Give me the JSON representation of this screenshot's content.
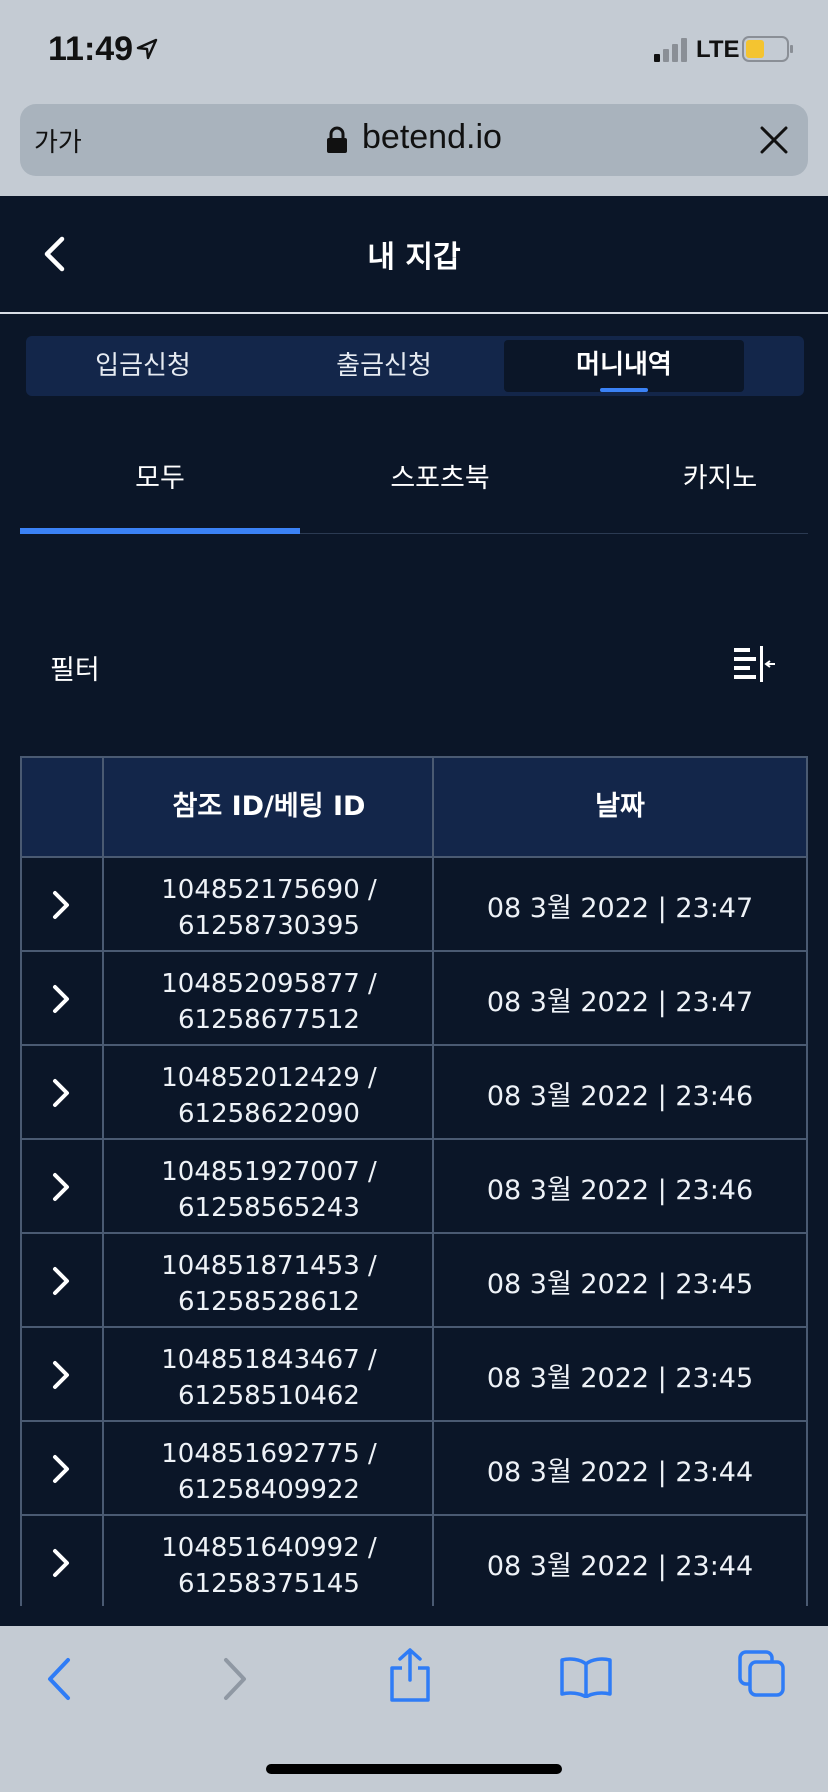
{
  "status_bar": {
    "time": "11:49",
    "network": "LTE"
  },
  "browser": {
    "text_size_label": "가가",
    "url": "betend.io"
  },
  "header": {
    "title": "내 지갑"
  },
  "tabs": [
    {
      "label": "입금신청",
      "active": false
    },
    {
      "label": "출금신청",
      "active": false
    },
    {
      "label": "머니내역",
      "active": true
    }
  ],
  "subtabs": [
    {
      "label": "모두",
      "active": true
    },
    {
      "label": "스포츠북",
      "active": false
    },
    {
      "label": "카지노",
      "active": false
    }
  ],
  "filter": {
    "label": "필터"
  },
  "table": {
    "headers": [
      "",
      "참조 ID/베팅 ID",
      "날짜"
    ],
    "rows": [
      {
        "ref_id": "104852175690 /",
        "bet_id": "61258730395",
        "date": "08 3월 2022 | 23:47"
      },
      {
        "ref_id": "104852095877 /",
        "bet_id": "61258677512",
        "date": "08 3월 2022 | 23:47"
      },
      {
        "ref_id": "104852012429 /",
        "bet_id": "61258622090",
        "date": "08 3월 2022 | 23:46"
      },
      {
        "ref_id": "104851927007 /",
        "bet_id": "61258565243",
        "date": "08 3월 2022 | 23:46"
      },
      {
        "ref_id": "104851871453 /",
        "bet_id": "61258528612",
        "date": "08 3월 2022 | 23:45"
      },
      {
        "ref_id": "104851843467 /",
        "bet_id": "61258510462",
        "date": "08 3월 2022 | 23:45"
      },
      {
        "ref_id": "104851692775 /",
        "bet_id": "61258409922",
        "date": "08 3월 2022 | 23:44"
      },
      {
        "ref_id": "104851640992 /",
        "bet_id": "61258375145",
        "date": "08 3월 2022 | 23:44"
      }
    ]
  },
  "colors": {
    "background": "#0b1628",
    "tab_bg": "#13264a",
    "accent": "#3b82f6",
    "border": "#4a5a72",
    "chrome": "#c4cbd3"
  }
}
